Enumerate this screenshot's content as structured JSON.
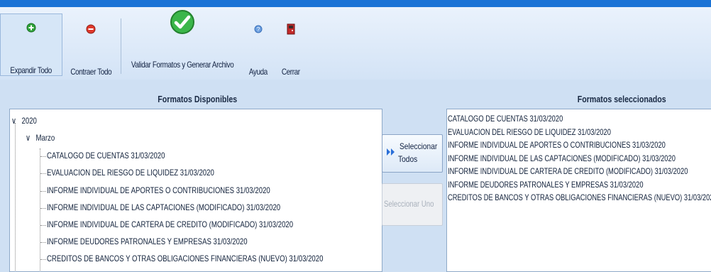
{
  "toolbar": {
    "expand_label": "Expandir Todo",
    "collapse_label": "Contraer Todo",
    "validate_label": "Validar Formatos y Generar Archivo",
    "help_label": "Ayuda",
    "close_label": "Cerrar"
  },
  "available": {
    "header": "Formatos Disponibles",
    "year": "2020",
    "month": "Marzo",
    "items": [
      "CATALOGO DE CUENTAS 31/03/2020",
      "EVALUACION DEL RIESGO DE LIQUIDEZ 31/03/2020",
      "INFORME INDIVIDUAL DE APORTES O CONTRIBUCIONES 31/03/2020",
      "INFORME INDIVIDUAL DE LAS CAPTACIONES (MODIFICADO) 31/03/2020",
      "INFORME INDIVIDUAL DE CARTERA DE CREDITO (MODIFICADO) 31/03/2020",
      "INFORME DEUDORES PATRONALES Y EMPRESAS 31/03/2020",
      "CREDITOS DE BANCOS Y OTRAS OBLIGACIONES FINANCIERAS (NUEVO) 31/03/2020"
    ]
  },
  "actions": {
    "select_all_line1": "Seleccionar",
    "select_all_line2": "Todos",
    "select_one": "Seleccionar Uno"
  },
  "selected": {
    "header": "Formatos seleccionados",
    "items": [
      "CATALOGO DE CUENTAS 31/03/2020",
      "EVALUACION DEL RIESGO DE LIQUIDEZ 31/03/2020",
      "INFORME INDIVIDUAL DE APORTES O CONTRIBUCIONES 31/03/2020",
      "INFORME INDIVIDUAL DE LAS CAPTACIONES (MODIFICADO) 31/03/2020",
      "INFORME INDIVIDUAL DE CARTERA DE CREDITO (MODIFICADO) 31/03/2020",
      "INFORME DEUDORES PATRONALES Y EMPRESAS 31/03/2020",
      "CREDITOS DE BANCOS Y OTRAS OBLIGACIONES FINANCIERAS (NUEVO) 31/03/2020"
    ]
  },
  "colors": {
    "accent": "#1a73d6",
    "toolbar_bg": "#dbe8f7",
    "body_bg": "#cfe0f3"
  },
  "icons": [
    "plus-green-icon",
    "minus-red-icon",
    "checkmark-icon",
    "help-icon",
    "exit-door-icon",
    "double-arrow-icon"
  ]
}
